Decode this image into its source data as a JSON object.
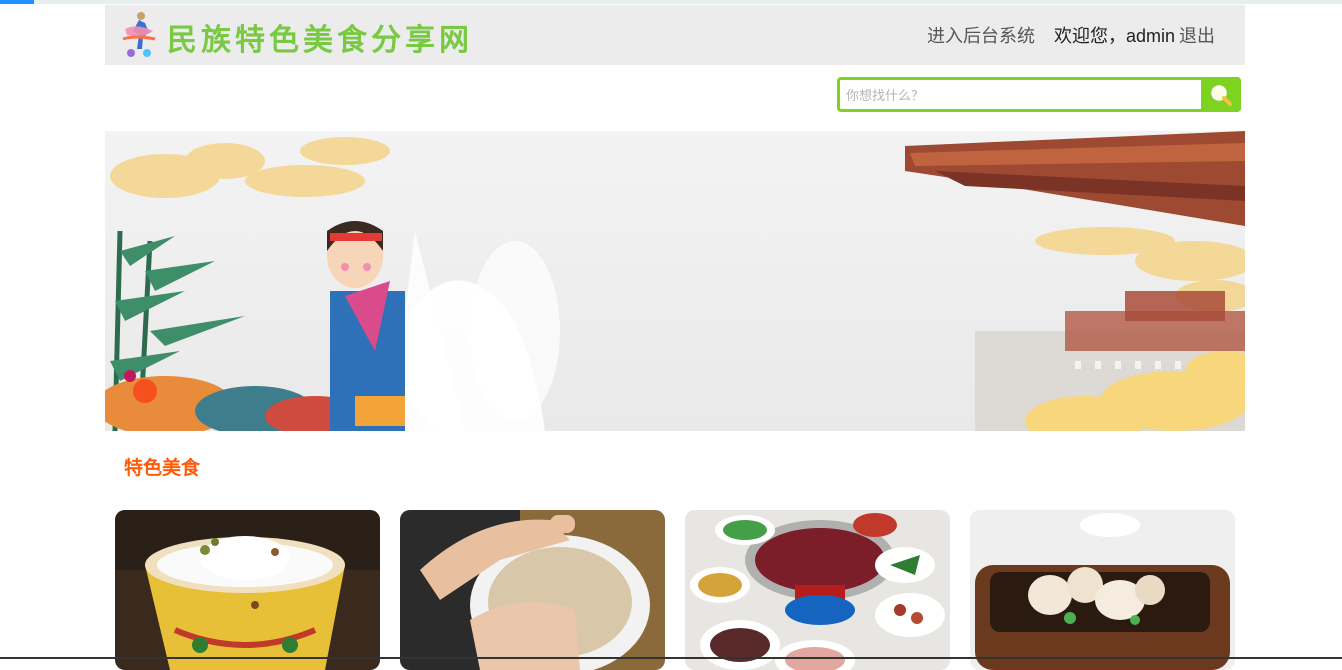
{
  "header": {
    "site_title": "民族特色美食分享网",
    "admin_link": "进入后台系统",
    "welcome": "欢迎您，admin",
    "logout": "退出"
  },
  "search": {
    "placeholder": "你想找什么？"
  },
  "section": {
    "title": "特色美食"
  },
  "food_cards": [
    {
      "image": "yogurt-bowl-image"
    },
    {
      "image": "tsampa-hands-image"
    },
    {
      "image": "hotpot-feast-image"
    },
    {
      "image": "bamboo-dish-image"
    }
  ],
  "colors": {
    "brand_green": "#7ac943",
    "search_green": "#7ed321",
    "section_orange": "#ff5a0a"
  }
}
